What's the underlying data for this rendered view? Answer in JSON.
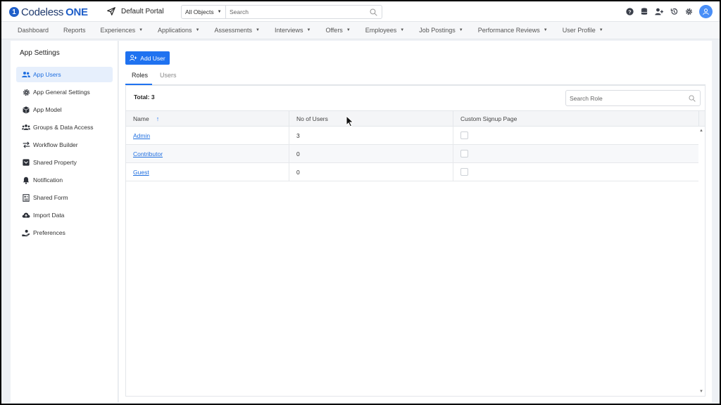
{
  "header": {
    "brand_prefix": "Codeless",
    "brand_suffix": "ONE",
    "portal_name": "Default Portal",
    "object_filter": "All Objects",
    "search_placeholder": "Search"
  },
  "nav": {
    "items": [
      {
        "label": "Dashboard",
        "dropdown": false
      },
      {
        "label": "Reports",
        "dropdown": false
      },
      {
        "label": "Experiences",
        "dropdown": true
      },
      {
        "label": "Applications",
        "dropdown": true
      },
      {
        "label": "Assessments",
        "dropdown": true
      },
      {
        "label": "Interviews",
        "dropdown": true
      },
      {
        "label": "Offers",
        "dropdown": true
      },
      {
        "label": "Employees",
        "dropdown": true
      },
      {
        "label": "Job Postings",
        "dropdown": true
      },
      {
        "label": "Performance Reviews",
        "dropdown": true
      },
      {
        "label": "User Profile",
        "dropdown": true
      }
    ]
  },
  "sidebar": {
    "title": "App Settings",
    "items": [
      {
        "label": "App Users",
        "icon": "users-icon",
        "active": true
      },
      {
        "label": "App General Settings",
        "icon": "gear-icon",
        "active": false
      },
      {
        "label": "App Model",
        "icon": "cube-icon",
        "active": false
      },
      {
        "label": "Groups & Data Access",
        "icon": "group-icon",
        "active": false
      },
      {
        "label": "Workflow Builder",
        "icon": "arrows-icon",
        "active": false
      },
      {
        "label": "Shared Property",
        "icon": "box-icon",
        "active": false
      },
      {
        "label": "Notification",
        "icon": "bell-icon",
        "active": false
      },
      {
        "label": "Shared Form",
        "icon": "form-icon",
        "active": false
      },
      {
        "label": "Import Data",
        "icon": "cloud-upload-icon",
        "active": false
      },
      {
        "label": "Preferences",
        "icon": "hand-user-icon",
        "active": false
      }
    ]
  },
  "main": {
    "add_user_label": "Add User",
    "tabs": [
      {
        "label": "Roles",
        "active": true
      },
      {
        "label": "Users",
        "active": false
      }
    ],
    "total_label": "Total: 3",
    "role_search_placeholder": "Search Role",
    "columns": [
      "Name",
      "No of Users",
      "Custom Signup Page"
    ],
    "rows": [
      {
        "name": "Admin",
        "users": "3",
        "custom_signup": false
      },
      {
        "name": "Contributor",
        "users": "0",
        "custom_signup": false
      },
      {
        "name": "Guest",
        "users": "0",
        "custom_signup": false
      }
    ]
  },
  "colors": {
    "accent": "#1f72f0",
    "brand": "#1f5fc9",
    "active_bg": "#e6effc"
  }
}
